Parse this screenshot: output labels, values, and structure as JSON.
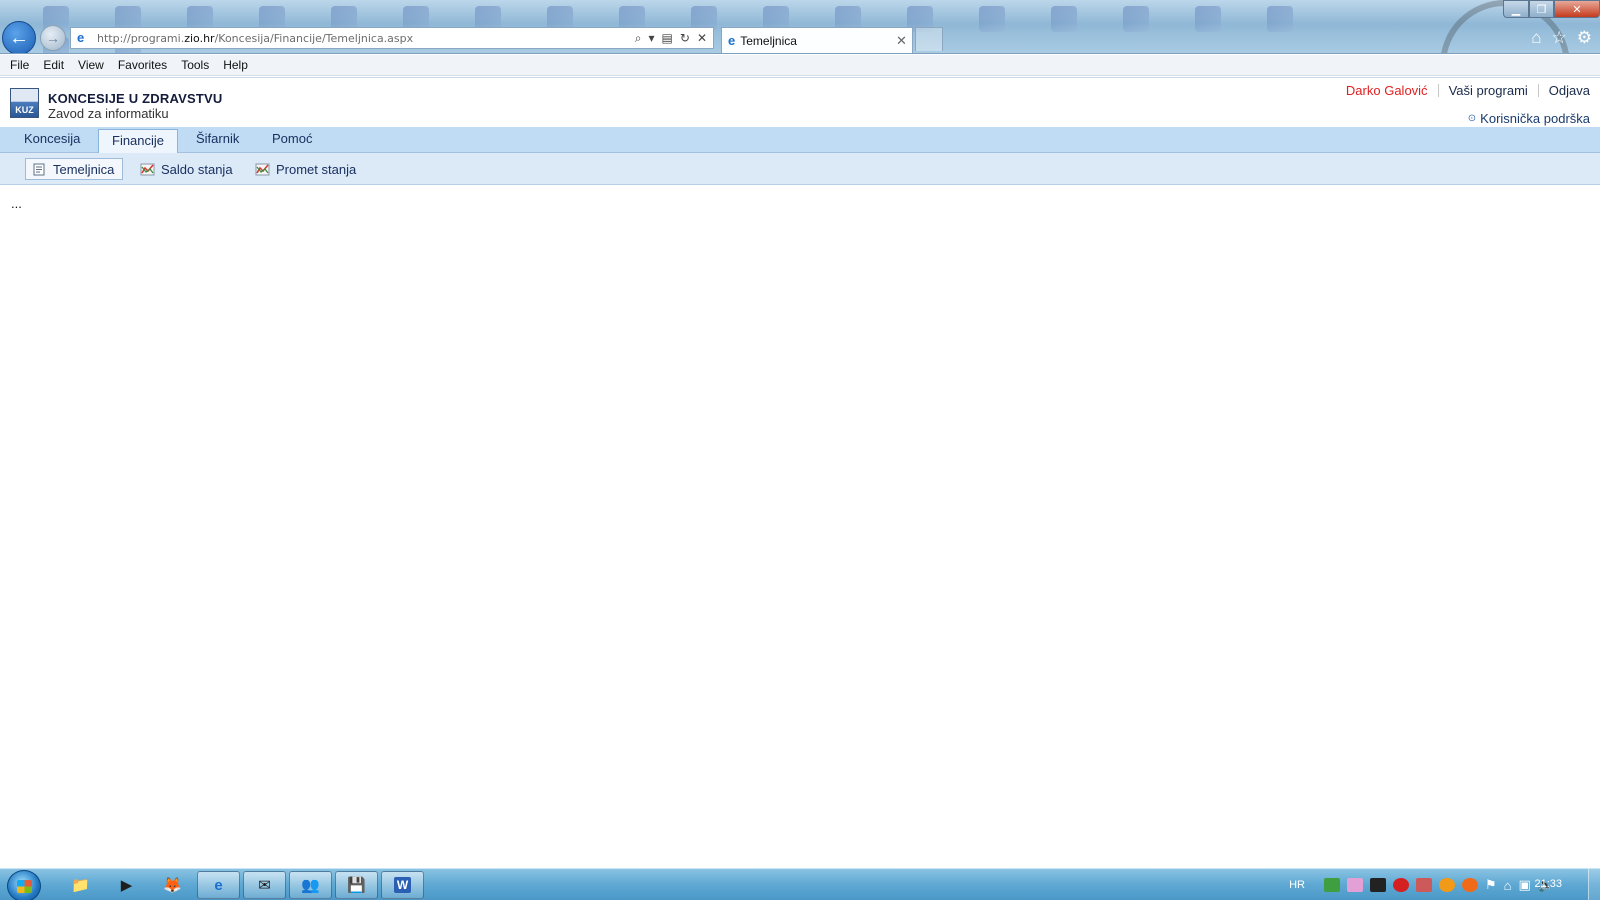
{
  "browser": {
    "address_prefix": "http://programi.",
    "address_host": "zio.hr",
    "address_path": "/Koncesija/Financije/Temeljnica.aspx",
    "tab_title": "Temeljnica",
    "menu": [
      "File",
      "Edit",
      "View",
      "Favorites",
      "Tools",
      "Help"
    ]
  },
  "app": {
    "title": "KONCESIJE U ZDRAVSTVU",
    "subtitle": "Zavod za informatiku",
    "logo_text": "KUZ",
    "user_name": "Darko Galović",
    "programs_link": "Vaši programi",
    "logout_link": "Odjava",
    "support_link": "Korisnička podrška"
  },
  "main_nav": [
    {
      "label": "Koncesija",
      "active": false
    },
    {
      "label": "Financije",
      "active": true
    },
    {
      "label": "Šifarnik",
      "active": false
    },
    {
      "label": "Pomoć",
      "active": false
    }
  ],
  "sub_nav": [
    {
      "label": "Temeljnica",
      "icon": "document-icon",
      "active": true
    },
    {
      "label": "Saldo stanja",
      "icon": "chart-icon",
      "active": false
    },
    {
      "label": "Promet stanja",
      "icon": "chart-icon",
      "active": false
    }
  ],
  "content": {
    "placeholder": "..."
  },
  "taskbar": {
    "language": "HR",
    "time": "21:33",
    "apps": [
      "folder-icon",
      "media-player-icon",
      "firefox-icon",
      "internet-explorer-icon",
      "mail-icon",
      "users-icon",
      "save-icon",
      "word-icon"
    ]
  },
  "colors": {
    "accent_nav": "#c0dbf4",
    "user_name": "#e02020",
    "title": "#141c3c"
  }
}
